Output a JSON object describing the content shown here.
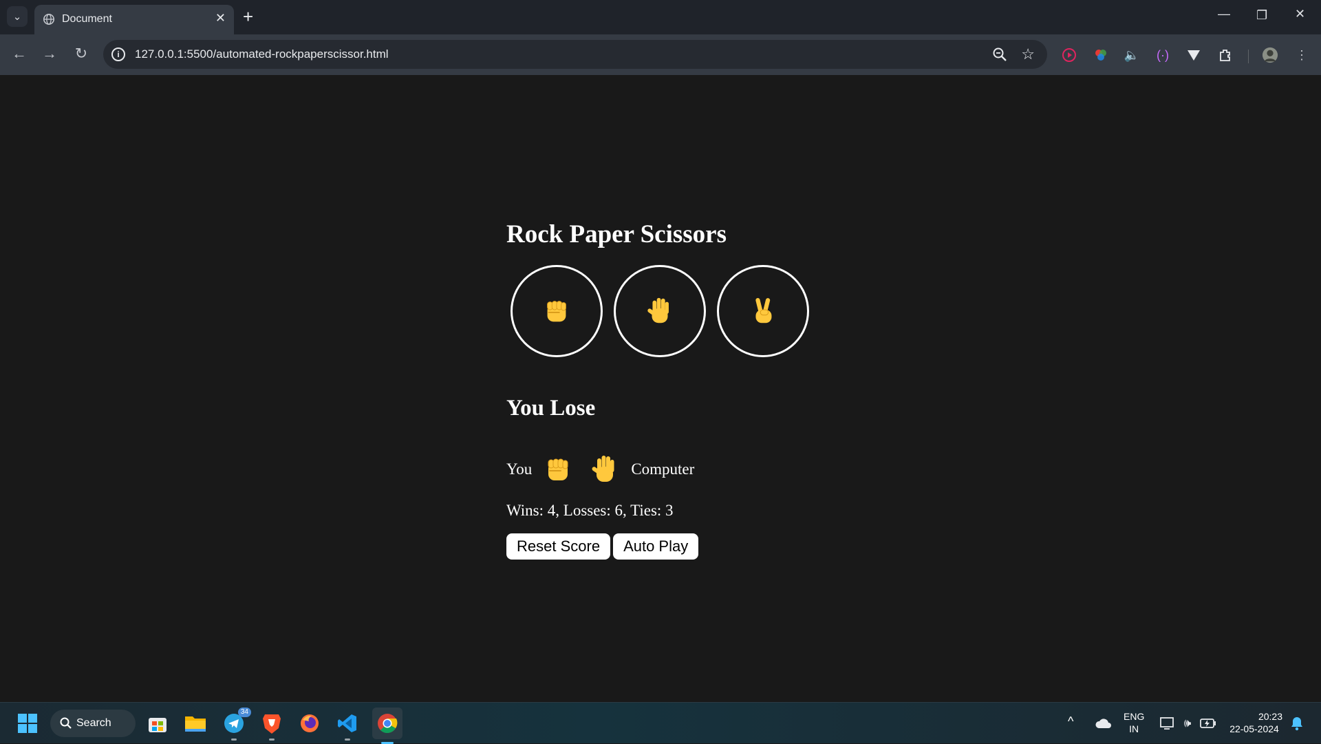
{
  "browser": {
    "tab_title": "Document",
    "tab_close": "✕",
    "new_tab": "+",
    "url": "127.0.0.1:5500/automated-rockpaperscissor.html",
    "accent": "#353b44"
  },
  "page": {
    "title": "Rock Paper Scissors",
    "moves": [
      {
        "name": "rock",
        "icon": "rock-fist-icon"
      },
      {
        "name": "paper",
        "icon": "paper-hand-icon"
      },
      {
        "name": "scissors",
        "icon": "scissors-peace-icon"
      }
    ],
    "result": "You Lose",
    "you_label": "You",
    "computer_label": "Computer",
    "player_move": "rock",
    "computer_move": "paper",
    "score": "Wins: 4, Losses: 6, Ties: 3",
    "reset_label": "Reset Score",
    "auto_play_label": "Auto Play",
    "emoji_color": "#ffc83d"
  },
  "taskbar": {
    "search_label": "Search",
    "telegram_badge": "34",
    "lang_line1": "ENG",
    "lang_line2": "IN",
    "time": "20:23",
    "date": "22-05-2024"
  }
}
